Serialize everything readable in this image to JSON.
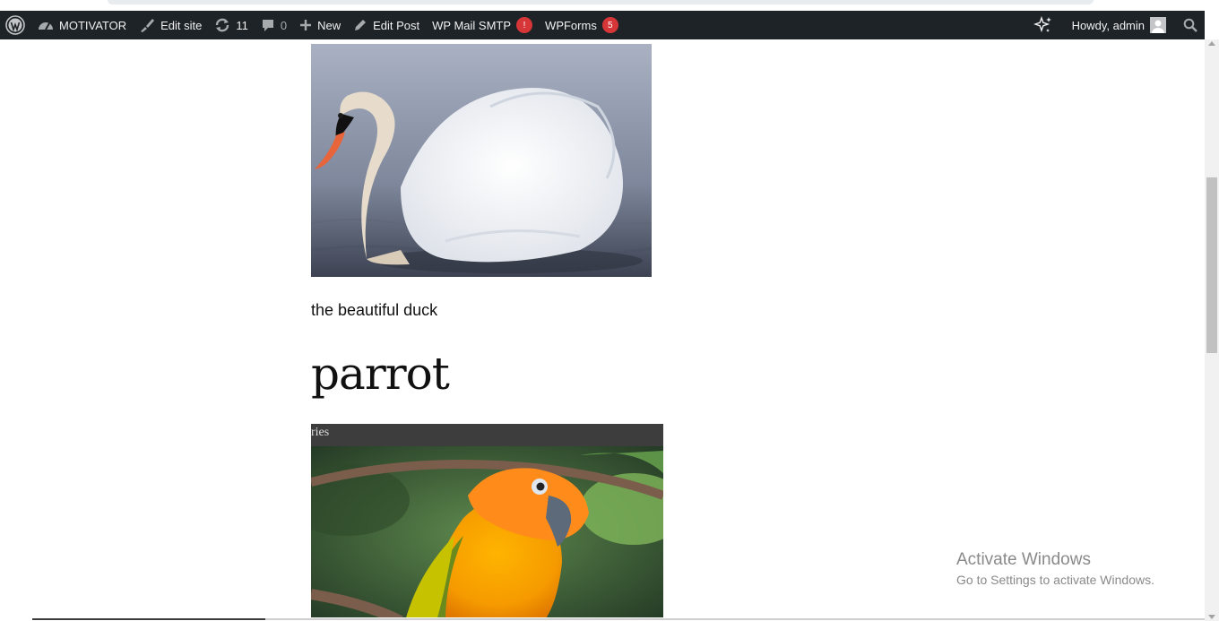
{
  "adminbar": {
    "site_name": "MOTIVATOR",
    "edit_site": "Edit site",
    "updates_count": "11",
    "comments_count": "0",
    "new_label": "New",
    "edit_post": "Edit Post",
    "wp_mail_smtp": "WP Mail SMTP",
    "wp_mail_smtp_badge": "!",
    "wpforms": "WPForms",
    "wpforms_badge": "5",
    "greeting": "Howdy, admin"
  },
  "content": {
    "swan_caption": "the beautiful duck",
    "parrot_heading": "parrot",
    "parrot_overlay_text": "ries"
  },
  "watermark": {
    "title": "Activate Windows",
    "subtitle": "Go to Settings to activate Windows."
  },
  "colors": {
    "adminbar_bg": "#1d2327",
    "badge_red": "#d63638"
  },
  "icons": [
    "wordpress-logo-icon",
    "dashboard-icon",
    "brush-icon",
    "updates-icon",
    "comment-icon",
    "plus-icon",
    "pencil-icon",
    "sparkle-icon",
    "search-icon"
  ]
}
